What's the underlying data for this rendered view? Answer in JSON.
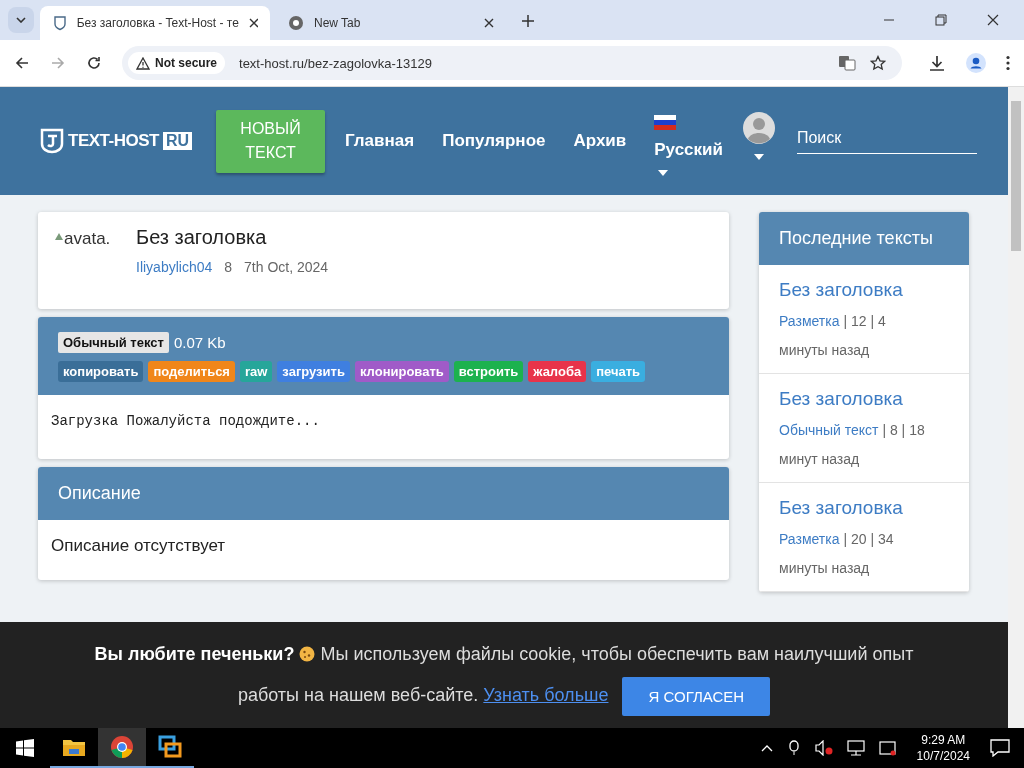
{
  "browser": {
    "tabs": [
      {
        "title": "Без заголовка - Text-Host - те",
        "selected": true
      },
      {
        "title": "New Tab",
        "selected": false
      }
    ],
    "security": "Not secure",
    "url": "text-host.ru/bez-zagolovka-13129"
  },
  "header": {
    "logo": "TEXT-HOST",
    "logo_badge": "RU",
    "new_button": "НОВЫЙ ТЕКСТ",
    "nav": [
      "Главная",
      "Популярное",
      "Архив"
    ],
    "language": "Русский",
    "search": {
      "placeholder": "Поиск"
    }
  },
  "paste": {
    "avatar_alt": "avata.",
    "title": "Без заголовка",
    "author": "Iliyabylich04",
    "views": "8",
    "date": "7th Oct, 2024",
    "syntax": "Обычный текст",
    "size": "0.07 Kb",
    "actions": [
      {
        "label": "копировать",
        "color": "#3a6e98"
      },
      {
        "label": "поделиться",
        "color": "#f0861a"
      },
      {
        "label": "raw",
        "color": "#26a69a"
      },
      {
        "label": "загрузить",
        "color": "#3f7fe0"
      },
      {
        "label": "клонировать",
        "color": "#a05bc8"
      },
      {
        "label": "встроить",
        "color": "#1cb24e"
      },
      {
        "label": "жалоба",
        "color": "#e8334a"
      },
      {
        "label": "печать",
        "color": "#3aaee0"
      }
    ],
    "content": "Загрузка Пожалуйста подождите..."
  },
  "description": {
    "title": "Описание",
    "text": "Описание отсутствует"
  },
  "sidebar": {
    "title": "Последние тексты",
    "items": [
      {
        "title": "Без заголовка",
        "syntax": "Разметка",
        "meta": " | 12 | 4",
        "age": "минуты назад"
      },
      {
        "title": "Без заголовка",
        "syntax": "Обычный текст",
        "meta": " | 8 | 18",
        "age": "минут назад"
      },
      {
        "title": "Без заголовка",
        "syntax": "Разметка",
        "meta": " | 20 | 34",
        "age": "минуты назад"
      }
    ]
  },
  "cookie": {
    "lead": "Вы любите печеньки?",
    "text": " Мы используем файлы cookie, чтобы обеспечить вам наилучший опыт работы на нашем веб-сайте. ",
    "link": "Узнать больше",
    "button": "Я СОГЛАСЕН"
  },
  "taskbar": {
    "apps": [
      {
        "kind": "folder",
        "selected": false
      },
      {
        "kind": "chrome",
        "selected": true
      },
      {
        "kind": "remote",
        "selected": false
      }
    ],
    "time": "9:29 AM",
    "date": "10/7/2024"
  }
}
